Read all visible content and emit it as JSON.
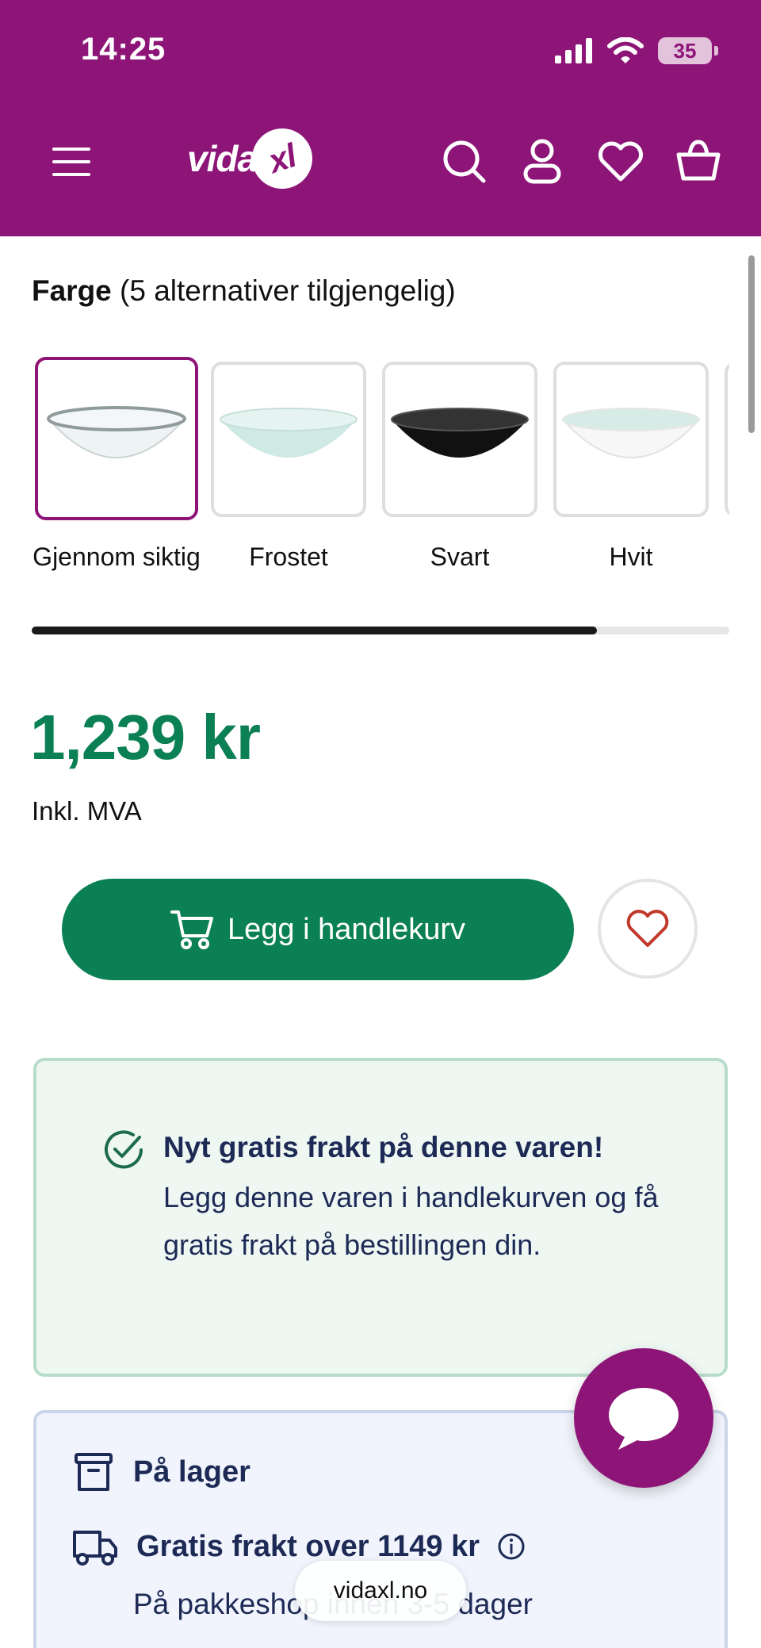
{
  "status_bar": {
    "time": "14:25",
    "battery": "35"
  },
  "header": {
    "logo_text": "vida",
    "logo_badge": "xl",
    "icons": [
      "menu-icon",
      "search-icon",
      "account-icon",
      "heart-icon",
      "basket-icon"
    ],
    "background": "#8e1578"
  },
  "color_selector": {
    "heading_bold": "Farge",
    "heading_rest": " (5 alternativer tilgjengelig)",
    "options": [
      {
        "label": "Gjennom siktig",
        "tint": "#e8f1f0",
        "selected": true
      },
      {
        "label": "Frostet",
        "tint": "#cfe9e4",
        "selected": false
      },
      {
        "label": "Svart",
        "tint": "#111111",
        "selected": false
      },
      {
        "label": "Hvit",
        "tint": "#f7f7f7",
        "selected": false
      }
    ],
    "scroll_progress": 0.81
  },
  "product": {
    "price": "1,239 kr",
    "vat_note": "Inkl. MVA",
    "add_to_cart_label": "Legg i handlekurv",
    "accent_color": "#0b8055"
  },
  "promo": {
    "title": "Nyt gratis frakt på denne varen!",
    "text": "Legg denne varen i handlekurven og få gratis frakt på bestillingen din."
  },
  "availability": {
    "stock_label": "På lager",
    "shipping_label": "Gratis frakt over 1149 kr",
    "shipping_sub": "På pakkeshop innen 3-5 dager"
  },
  "browser": {
    "url": "vidaxl.no"
  }
}
